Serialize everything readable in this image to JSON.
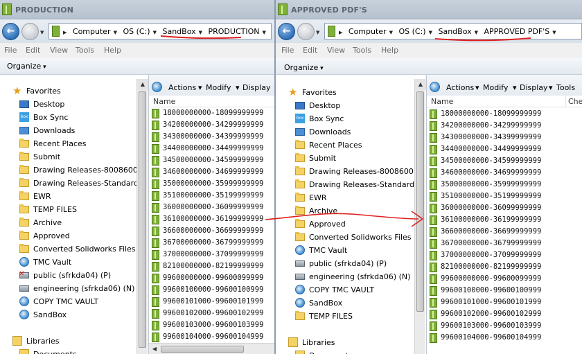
{
  "left_window": {
    "title": "PRODUCTION",
    "breadcrumb": [
      "Computer",
      "OS (C:)",
      "SandBox",
      "PRODUCTION"
    ],
    "menu": [
      "File",
      "Edit",
      "View",
      "Tools",
      "Help"
    ],
    "organize_label": "Organize",
    "nav_items": [
      {
        "label": "Favorites",
        "icon": "star-icon"
      },
      {
        "label": "Desktop",
        "icon": "desktop-icon"
      },
      {
        "label": "Box Sync",
        "icon": "box-sync-icon"
      },
      {
        "label": "Downloads",
        "icon": "downloads-icon"
      },
      {
        "label": "Recent Places",
        "icon": "recent-places-icon"
      },
      {
        "label": "Submit",
        "icon": "folder-icon"
      },
      {
        "label": "Drawing Releases-8008600",
        "icon": "folder-icon"
      },
      {
        "label": "Drawing Releases-Standard",
        "icon": "folder-icon"
      },
      {
        "label": "EWR",
        "icon": "folder-icon"
      },
      {
        "label": "TEMP FILES",
        "icon": "folder-icon"
      },
      {
        "label": "Archive",
        "icon": "folder-icon"
      },
      {
        "label": "Approved",
        "icon": "folder-icon"
      },
      {
        "label": "Converted Solidworks Files",
        "icon": "folder-icon"
      },
      {
        "label": "TMC Vault",
        "icon": "network-location-icon"
      },
      {
        "label": "public (sfrkda04) (P)",
        "icon": "disconnected-drive-icon"
      },
      {
        "label": "engineering (sfrkda06) (N)",
        "icon": "network-drive-icon"
      },
      {
        "label": "COPY TMC VAULT",
        "icon": "network-location-icon"
      },
      {
        "label": "SandBox",
        "icon": "network-location-icon"
      },
      {
        "label": "Libraries",
        "icon": "libraries-icon"
      },
      {
        "label": "Documents",
        "icon": "documents-icon"
      }
    ],
    "pane_toolbar": [
      "Actions",
      "Modify",
      "Display"
    ],
    "column_name": "Name",
    "files": [
      "18000000000-18099999999",
      "34200000000-34299999999",
      "34300000000-34399999999",
      "34400000000-34499999999",
      "34500000000-34599999999",
      "34600000000-34699999999",
      "35000000000-35999999999",
      "35100000000-35199999999",
      "36000000000-36099999999",
      "36100000000-36199999999",
      "36600000000-36699999999",
      "36700000000-36799999999",
      "37000000000-37099999999",
      "82100000000-82199999999",
      "99600000000-99600099999",
      "99600100000-99600100999",
      "99600101000-99600101999",
      "99600102000-99600102999",
      "99600103000-99600103999",
      "99600104000-99600104999"
    ]
  },
  "right_window": {
    "title": "APPROVED PDF'S",
    "breadcrumb": [
      "Computer",
      "OS (C:)",
      "SandBox",
      "APPROVED PDF'S"
    ],
    "menu": [
      "File",
      "Edit",
      "View",
      "Tools",
      "Help"
    ],
    "organize_label": "Organize",
    "nav_items": [
      {
        "label": "Favorites",
        "icon": "star-icon"
      },
      {
        "label": "Desktop",
        "icon": "desktop-icon"
      },
      {
        "label": "Box Sync",
        "icon": "box-sync-icon"
      },
      {
        "label": "Downloads",
        "icon": "downloads-icon"
      },
      {
        "label": "Recent Places",
        "icon": "recent-places-icon"
      },
      {
        "label": "Submit",
        "icon": "folder-icon"
      },
      {
        "label": "Drawing Releases-8008600",
        "icon": "folder-icon"
      },
      {
        "label": "Drawing Releases-Standard",
        "icon": "folder-icon"
      },
      {
        "label": "EWR",
        "icon": "folder-icon"
      },
      {
        "label": "Archive",
        "icon": "folder-icon"
      },
      {
        "label": "Approved",
        "icon": "folder-icon"
      },
      {
        "label": "Converted Solidworks Files",
        "icon": "folder-icon"
      },
      {
        "label": "TMC Vault",
        "icon": "network-location-icon"
      },
      {
        "label": "public (sfrkda04) (P)",
        "icon": "network-drive-icon"
      },
      {
        "label": "engineering (sfrkda06) (N)",
        "icon": "network-drive-icon"
      },
      {
        "label": "COPY TMC VAULT",
        "icon": "network-location-icon"
      },
      {
        "label": "SandBox",
        "icon": "network-location-icon"
      },
      {
        "label": "TEMP FILES",
        "icon": "folder-icon"
      },
      {
        "label": "Libraries",
        "icon": "libraries-icon"
      },
      {
        "label": "Documents",
        "icon": "documents-icon"
      }
    ],
    "pane_toolbar": [
      "Actions",
      "Modify",
      "Display",
      "Tools"
    ],
    "column_name": "Name",
    "column_second": "Che",
    "files": [
      "18000000000-18099999999",
      "34200000000-34299999999",
      "34300000000-34399999999",
      "34400000000-34499999999",
      "34500000000-34599999999",
      "34600000000-34699999999",
      "35000000000-35999999999",
      "35100000000-35199999999",
      "36000000000-36099999999",
      "36100000000-36199999999",
      "36600000000-36699999999",
      "36700000000-36799999999",
      "37000000000-37099999999",
      "82100000000-82199999999",
      "99600000000-99600099999",
      "99600100000-99600100999",
      "99600101000-99600101999",
      "99600102000-99600102999",
      "99600103000-99600103999",
      "99600104000-99600104999"
    ]
  },
  "annotation_color": "#e02020"
}
